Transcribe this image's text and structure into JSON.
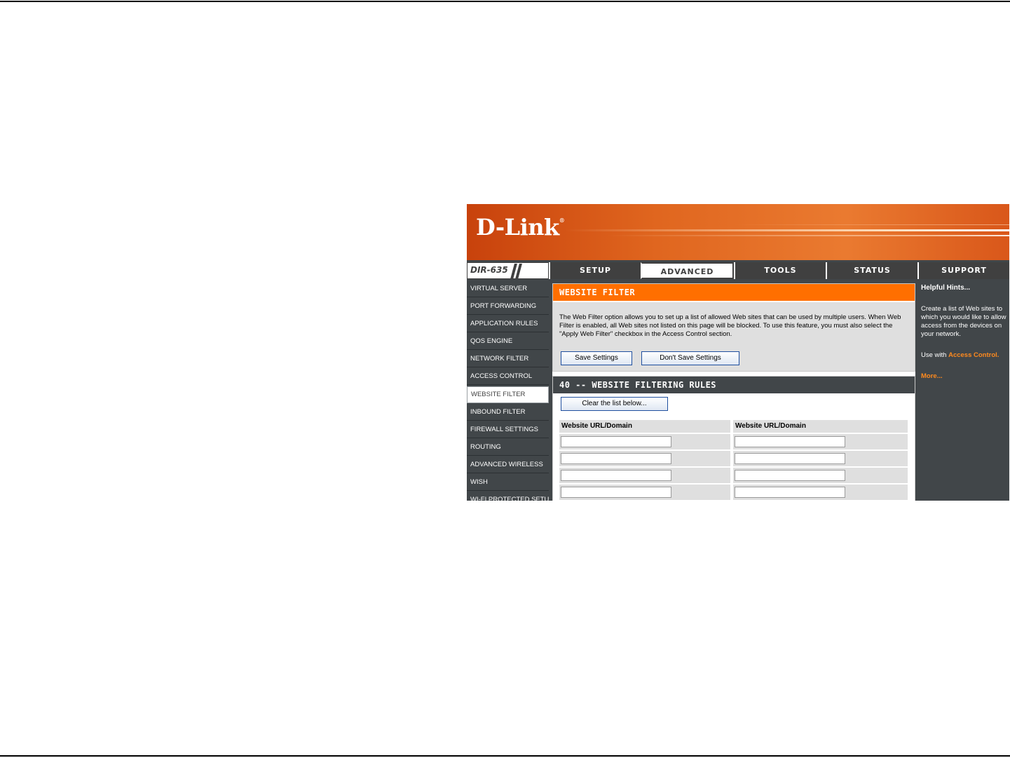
{
  "brand": {
    "logo_text": "D-Link"
  },
  "model": {
    "label": "DIR-635"
  },
  "tabs": [
    {
      "label": "SETUP"
    },
    {
      "label": "ADVANCED"
    },
    {
      "label": "TOOLS"
    },
    {
      "label": "STATUS"
    },
    {
      "label": "SUPPORT"
    }
  ],
  "sidebar": {
    "items": [
      {
        "label": "VIRTUAL SERVER"
      },
      {
        "label": "PORT FORWARDING"
      },
      {
        "label": "APPLICATION RULES"
      },
      {
        "label": "QOS ENGINE"
      },
      {
        "label": "NETWORK FILTER"
      },
      {
        "label": "ACCESS CONTROL"
      },
      {
        "label": "WEBSITE FILTER"
      },
      {
        "label": "INBOUND FILTER"
      },
      {
        "label": "FIREWALL SETTINGS"
      },
      {
        "label": "ROUTING"
      },
      {
        "label": "ADVANCED WIRELESS"
      },
      {
        "label": "WISH"
      },
      {
        "label": "WI-FI PROTECTED SETUP"
      }
    ]
  },
  "website_filter": {
    "title": "WEBSITE FILTER",
    "description": "The Web Filter option allows you to set up a list of allowed Web sites that can be used by multiple users. When Web Filter is enabled, all Web sites not listed on this page will be blocked. To use this feature, you must also select the \"Apply Web Filter\" checkbox in the Access Control section.",
    "save_label": "Save Settings",
    "dont_save_label": "Don't Save Settings"
  },
  "rules": {
    "title": "40 -- WEBSITE FILTERING RULES",
    "clear_label": "Clear the list below...",
    "col_left": "Website URL/Domain",
    "col_right": "Website URL/Domain"
  },
  "help": {
    "title": "Helpful Hints...",
    "text1": "Create a list of Web sites to which you would like to allow access from the devices on your network.",
    "text2_prefix": "Use with",
    "text2_link": "Access Control.",
    "more": "More..."
  }
}
